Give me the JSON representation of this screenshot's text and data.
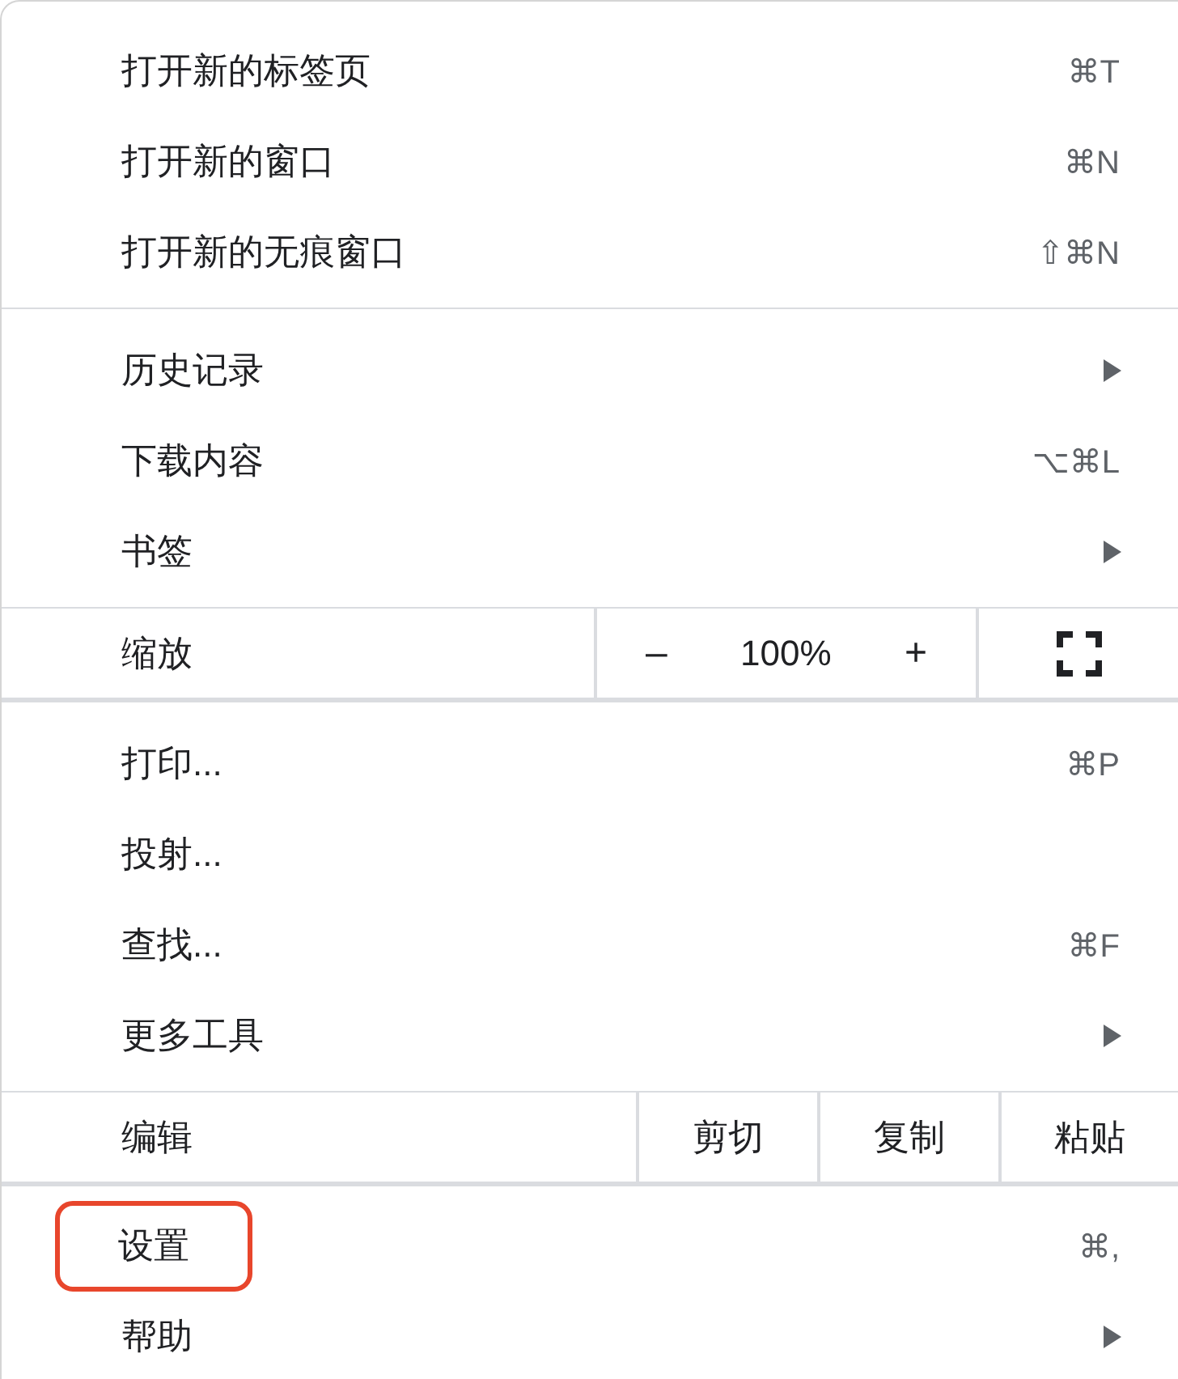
{
  "sections": [
    {
      "items": [
        {
          "kind": "command",
          "label": "打开新的标签页",
          "shortcut": "⌘T",
          "highlighted": false
        },
        {
          "kind": "command",
          "label": "打开新的窗口",
          "shortcut": "⌘N",
          "highlighted": false
        },
        {
          "kind": "command",
          "label": "打开新的无痕窗口",
          "shortcut": "⇧⌘N",
          "highlighted": false
        }
      ]
    },
    {
      "items": [
        {
          "kind": "submenu",
          "label": "历史记录",
          "highlighted": false
        },
        {
          "kind": "command",
          "label": "下载内容",
          "shortcut": "⌥⌘L",
          "highlighted": false
        },
        {
          "kind": "submenu",
          "label": "书签",
          "highlighted": false
        }
      ]
    },
    {
      "items": [
        {
          "kind": "zoom",
          "label": "缩放",
          "zoom_out": "–",
          "value": "100%",
          "zoom_in": "+"
        }
      ]
    },
    {
      "items": [
        {
          "kind": "command",
          "label": "打印...",
          "shortcut": "⌘P",
          "highlighted": false
        },
        {
          "kind": "command",
          "label": "投射...",
          "highlighted": false
        },
        {
          "kind": "command",
          "label": "查找...",
          "shortcut": "⌘F",
          "highlighted": false
        },
        {
          "kind": "submenu",
          "label": "更多工具",
          "highlighted": false
        }
      ]
    },
    {
      "items": [
        {
          "kind": "edit",
          "label": "编辑",
          "actions": [
            "剪切",
            "复制",
            "粘贴"
          ]
        }
      ]
    },
    {
      "items": [
        {
          "kind": "command",
          "label": "设置",
          "shortcut": "⌘,",
          "highlighted": true
        },
        {
          "kind": "submenu",
          "label": "帮助",
          "highlighted": false
        }
      ]
    }
  ]
}
